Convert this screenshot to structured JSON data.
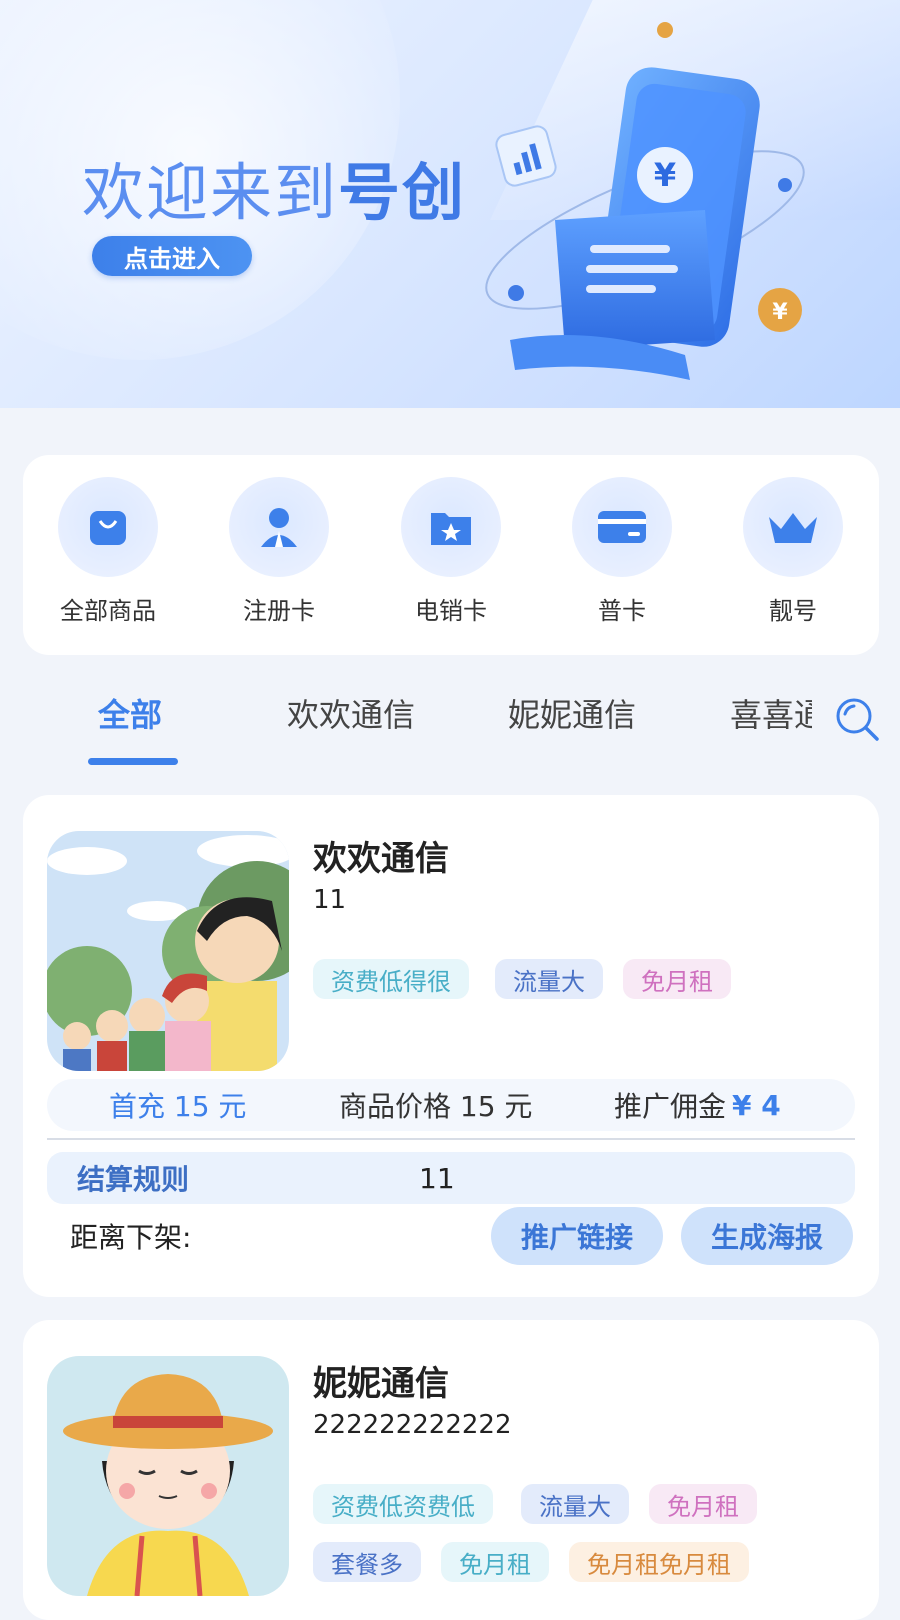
{
  "banner": {
    "title_light": "欢迎来到",
    "title_bold": "号创",
    "enter_label": "点击进入"
  },
  "categories": [
    {
      "label": "全部商品",
      "icon": "shopping-bag-icon"
    },
    {
      "label": "注册卡",
      "icon": "user-badge-icon"
    },
    {
      "label": "电销卡",
      "icon": "star-folder-icon"
    },
    {
      "label": "普卡",
      "icon": "bank-card-icon"
    },
    {
      "label": "靓号",
      "icon": "crown-icon"
    }
  ],
  "tabs": [
    "全部",
    "欢欢通信",
    "妮妮通信",
    "喜喜通信"
  ],
  "active_tab": "全部",
  "products": [
    {
      "name": "欢欢通信",
      "desc": "11",
      "tags": [
        "资费低得很",
        "流量大",
        "免月租"
      ],
      "first_charge": "首充 15 元",
      "goods_price": "商品价格 15 元",
      "commission_label": "推广佣金",
      "commission_amount": "¥ 4",
      "rule_label": "结算规则",
      "rule_value": "11",
      "deadline_label": "距离下架:",
      "promo_link_label": "推广链接",
      "poster_label": "生成海报"
    },
    {
      "name": "妮妮通信",
      "desc": "222222222222",
      "tags": [
        "资费低资费低",
        "流量大",
        "免月租",
        "套餐多",
        "免月租",
        "免月租免月租"
      ]
    }
  ],
  "colors": {
    "accent": "#3d80ea",
    "page_bg": "#f1f4fa"
  }
}
